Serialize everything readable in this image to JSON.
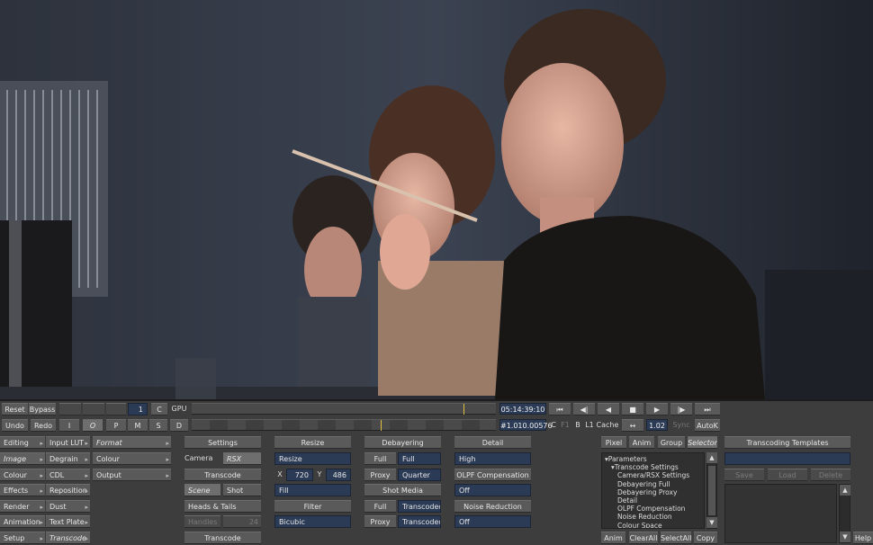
{
  "top_row": {
    "reset": "Reset",
    "bypass": "Bypass",
    "frame_field": "1",
    "c_btn": "C",
    "gpu": "GPU",
    "timecode": "05:14:39:10",
    "transport": [
      "⏮",
      "◀|",
      "◀",
      "■",
      "▶",
      "|▶",
      "⏭"
    ]
  },
  "second_row": {
    "undo": "Undo",
    "redo": "Redo",
    "i": "I",
    "o": "O",
    "p": "P",
    "m": "M",
    "s": "S",
    "d": "D",
    "frame_code": "#1.010.00576",
    "c": "C",
    "f1": "F1",
    "b": "B",
    "l1": "L1",
    "cache": "Cache",
    "arrows_icon": "↔",
    "value": "1.02",
    "sync": "Sync",
    "autok": "AutoK"
  },
  "menu": {
    "col1": [
      "Editing",
      "Image",
      "Colour",
      "Effects",
      "Render",
      "Animation",
      "Setup"
    ],
    "col2": [
      "Input LUT",
      "Degrain",
      "CDL",
      "Reposition",
      "Dust",
      "Text Plate",
      "Transcode"
    ],
    "col3": [
      "Format",
      "Colour",
      "Output"
    ]
  },
  "settings": {
    "title": "Settings",
    "camera": "Camera",
    "rsx": "RSX",
    "transcode": "Transcode",
    "scene": "Scene",
    "shot": "Shot",
    "heads_tails": "Heads & Tails",
    "handles": "Handles",
    "handles_value": "24",
    "transcode_btn": "Transcode"
  },
  "resize": {
    "title": "Resize",
    "mode": "Resize",
    "x_label": "X",
    "x_value": "720",
    "y_label": "Y",
    "y_value": "486",
    "fit": "Fill",
    "filter_title": "Filter",
    "filter_value": "Bicubic"
  },
  "debayer": {
    "title": "Debayering",
    "full": "Full",
    "full_value": "Full",
    "proxy": "Proxy",
    "proxy_value": "Quarter",
    "shot_media": "Shot Media",
    "sm_full": "Full",
    "sm_full_value": "Transcoded",
    "sm_proxy": "Proxy",
    "sm_proxy_value": "Transcoded"
  },
  "detail": {
    "title": "Detail",
    "value": "High",
    "olpf_title": "OLPF Compensation",
    "olpf_value": "Off",
    "noise_title": "Noise Reduction",
    "noise_value": "Off"
  },
  "params": {
    "tabs": [
      "Pixel",
      "Anim",
      "Group",
      "Selector"
    ],
    "tree": [
      "▾Parameters",
      "  ▾Transcode Settings",
      "    Camera/RSX Settings",
      "    Debayering Full",
      "    Debayering Proxy",
      "    Detail",
      "    OLPF Compensation",
      "    Noise Reduction",
      "    Colour Space"
    ],
    "bottom": [
      "Anim",
      "ClearAll",
      "SelectAll",
      "Copy"
    ]
  },
  "templates": {
    "title": "Transcoding Templates",
    "save": "Save",
    "load": "Load",
    "delete": "Delete",
    "help": "Help"
  }
}
